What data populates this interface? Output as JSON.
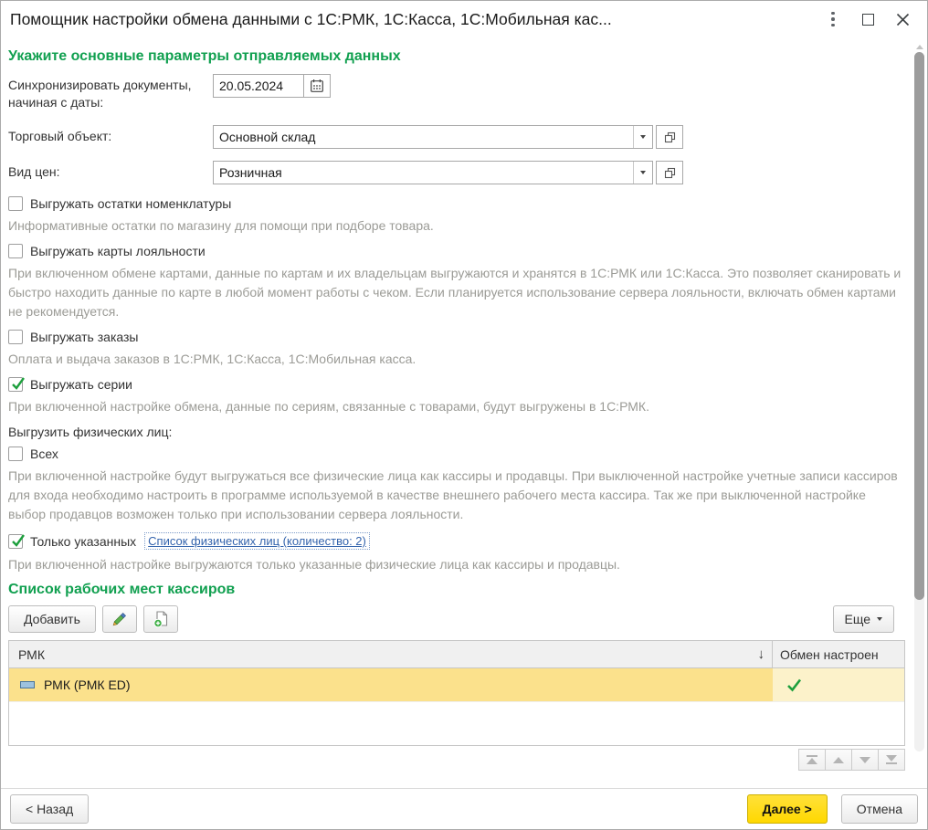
{
  "window": {
    "title": "Помощник настройки обмена данными с 1С:РМК, 1С:Касса, 1С:Мобильная кас..."
  },
  "params": {
    "heading": "Укажите основные параметры отправляемых данных",
    "sync_date_label": "Синхронизировать документы, начиная с даты:",
    "sync_date_value": "20.05.2024",
    "trade_object_label": "Торговый объект:",
    "trade_object_value": "Основной склад",
    "price_kind_label": "Вид цен:",
    "price_kind_value": "Розничная"
  },
  "options": [
    {
      "label": "Выгружать остатки номенклатуры",
      "checked": false,
      "description": "Информативные остатки по магазину для помощи при подборе товара."
    },
    {
      "label": "Выгружать карты лояльности",
      "checked": false,
      "description": "При включенном обмене картами, данные по картам и их владельцам выгружаются и хранятся в 1С:РМК или 1С:Касса. Это позволяет сканировать и быстро находить данные по карте в любой момент работы с чеком. Если планируется использование сервера лояльности, включать обмен картами не рекомендуется."
    },
    {
      "label": "Выгружать заказы",
      "checked": false,
      "description": "Оплата и выдача заказов в 1С:РМК, 1С:Касса, 1С:Мобильная касса."
    },
    {
      "label": "Выгружать серии",
      "checked": true,
      "description": "При включенной настройке обмена, данные по сериям, связанные с товарами, будут выгружены в 1С:РМК."
    }
  ],
  "persons": {
    "label": "Выгрузить физических лиц:",
    "all_label": "Всех",
    "all_checked": false,
    "all_description": "При включенной настройке будут выгружаться все физические лица как кассиры и продавцы. При выключенной настройке учетные записи кассиров для входа необходимо настроить в программе используемой в качестве внешнего рабочего места кассира. Так же при выключенной настройке выбор продавцов возможен только при использовании сервера лояльности.",
    "selected_label": "Только указанных",
    "selected_checked": true,
    "selected_link": "Список физических лиц (количество: 2)",
    "selected_description": "При включенной настройке выгружаются только указанные физические лица как кассиры и продавцы."
  },
  "workplaces": {
    "heading": "Список рабочих мест кассиров",
    "add_button": "Добавить",
    "more_button": "Еще",
    "table": {
      "columns": [
        "РМК",
        "Обмен настроен"
      ],
      "sort_icon": "↓",
      "rows": [
        {
          "name": "РМК (РМК ED)",
          "exchange_configured": true
        }
      ]
    }
  },
  "footer": {
    "back": "< Назад",
    "next": "Далее >",
    "cancel": "Отмена"
  },
  "colors": {
    "heading_green": "#11a050",
    "check_green": "#1d9f3d",
    "link_blue": "#3464ad",
    "row_highlight": "#fbe18c",
    "row_highlight_light": "#fcf2ca",
    "next_button_yellow": "#ffd800"
  }
}
